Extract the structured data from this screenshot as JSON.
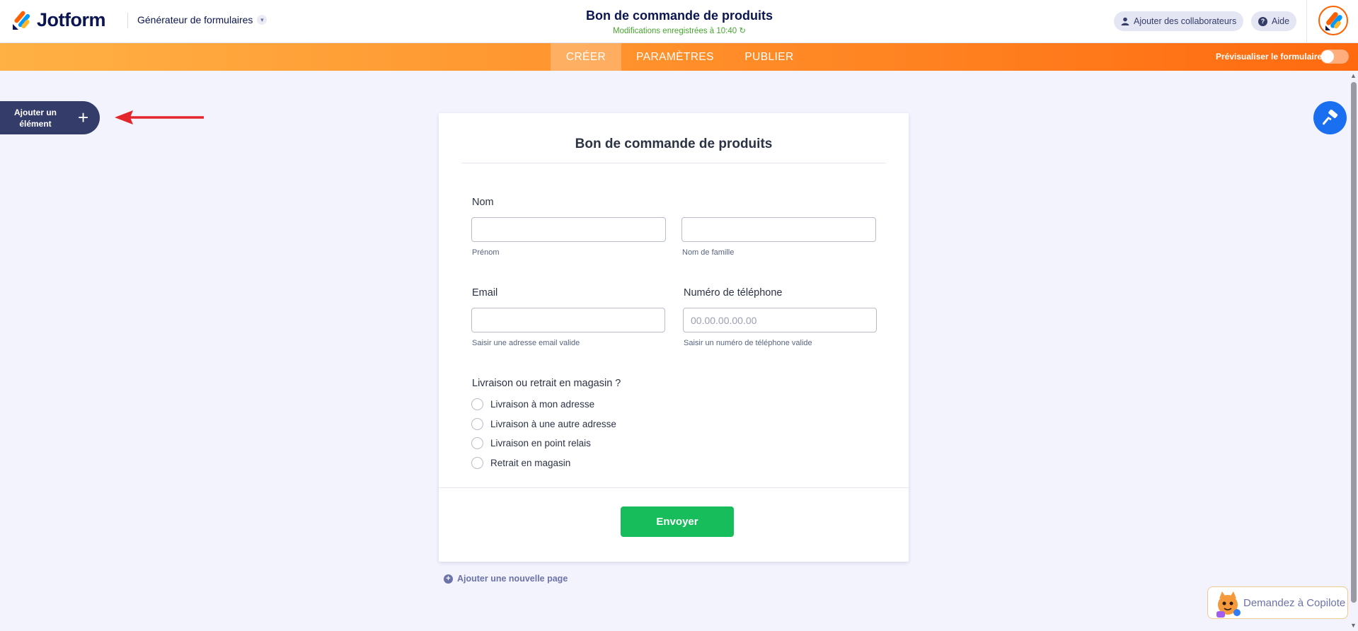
{
  "header": {
    "logo_text": "Jotform",
    "builder_label": "Générateur de formulaires",
    "form_title": "Bon de commande de produits",
    "saved_note": "Modifications enregistrées à 10:40",
    "collaborators_label": "Ajouter des collaborateurs",
    "help_label": "Aide"
  },
  "nav": {
    "tabs": [
      {
        "label": "CRÉER",
        "active": true
      },
      {
        "label": "PARAMÈTRES",
        "active": false
      },
      {
        "label": "PUBLIER",
        "active": false
      }
    ],
    "preview_label": "Prévisualiser le formulaire",
    "preview_on": false
  },
  "sidebar": {
    "add_element_line1": "Ajouter un",
    "add_element_line2": "élément",
    "add_icon": "+"
  },
  "form": {
    "title": "Bon de commande de produits",
    "name_label": "Nom",
    "first_name_sub": "Prénom",
    "last_name_sub": "Nom de famille",
    "email_label": "Email",
    "email_sub": "Saisir une adresse email valide",
    "phone_label": "Numéro de téléphone",
    "phone_placeholder": "00.00.00.00.00",
    "phone_sub": "Saisir un numéro de téléphone valide",
    "delivery_label": "Livraison ou retrait en magasin ?",
    "delivery_options": [
      "Livraison à mon adresse",
      "Livraison à une autre adresse",
      "Livraison en point relais",
      "Retrait en magasin"
    ],
    "submit_label": "Envoyer"
  },
  "add_page_label": "Ajouter une nouvelle page",
  "copilot_label": "Demandez à Copilote",
  "colors": {
    "navy": "#0a1551",
    "orange_start": "#ffb144",
    "orange_end": "#ff6a10",
    "submit_green": "#18bd5b",
    "accent_blue": "#1a6ff0",
    "arrow_red": "#e3262b"
  }
}
